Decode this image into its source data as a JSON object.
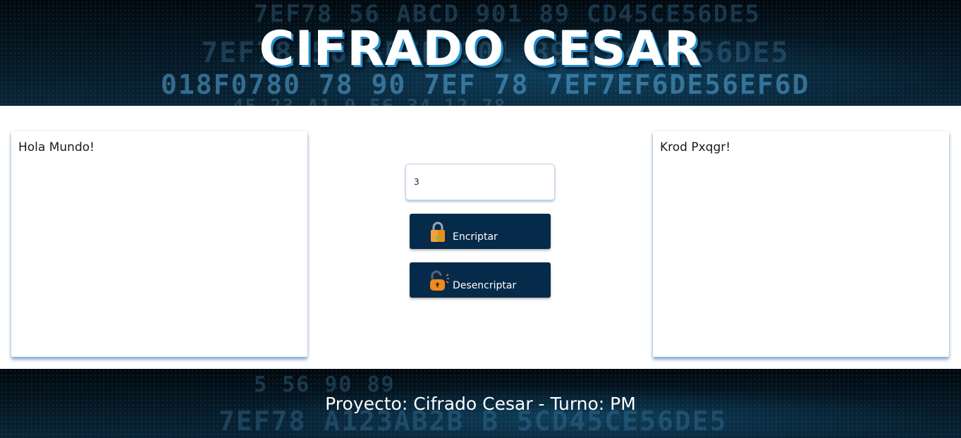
{
  "header": {
    "title": "CIFRADO CESAR",
    "background_hex": [
      "7EF78  56  ABCD  901  89  CD45CE56DE5",
      "018F0780  78  90 7EF 78  7EF7EF6DE56EF6D",
      "45  23  A1  9  56  34  12  78"
    ]
  },
  "left_panel": {
    "text": "Hola Mundo!"
  },
  "right_panel": {
    "text": "Krod Pxqgr!"
  },
  "controls": {
    "shift_value": "3",
    "encrypt_label": "Encriptar",
    "decrypt_label": "Desencriptar",
    "encrypt_icon": "padlock-closed-icon",
    "decrypt_icon": "padlock-open-icon"
  },
  "footer": {
    "text": "Proyecto: Cifrado Cesar - Turno: PM",
    "background_hex": [
      "5  56  90  89",
      "7EF78  A123AB2B B  5CD45CE56DE5"
    ]
  },
  "colors": {
    "button_bg": "#062a4a",
    "title_shadow": "#1f8fd0",
    "panel_shadow": "#3c78be",
    "icon_orange": "#f08a1c"
  }
}
